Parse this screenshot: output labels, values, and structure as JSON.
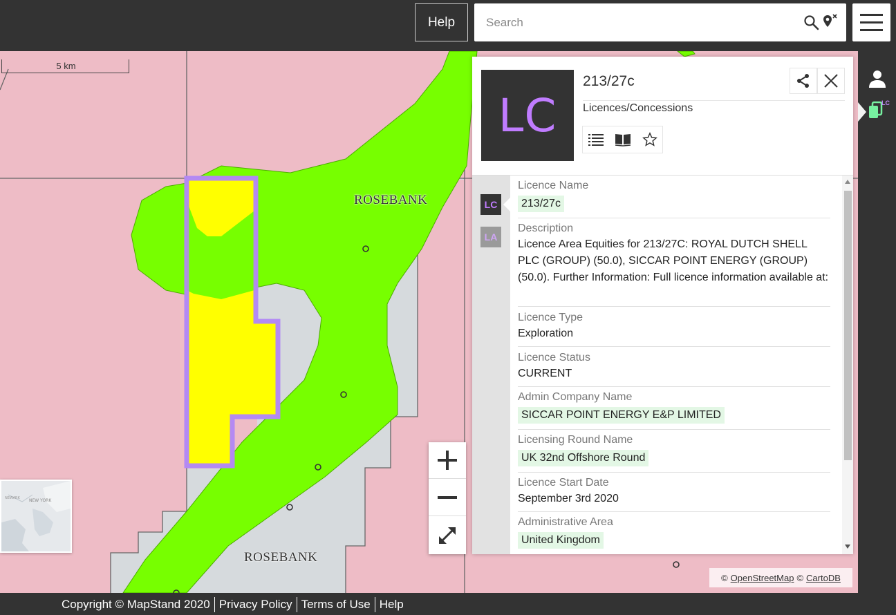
{
  "header": {
    "help_label": "Help",
    "search_placeholder": "Search",
    "search_icon": "search-icon",
    "location_icon": "map-pin-clear-icon",
    "menu_icon": "hamburger-menu-icon"
  },
  "map": {
    "scale_label": "5 km",
    "labels": [
      "ROSEBANK",
      "ROSEBANK"
    ],
    "colors": {
      "background": "#eebcc6",
      "field_green": "#77ff00",
      "block_grey": "#d6dadd",
      "selected_yellow": "#ffff00",
      "selection_outline": "#b388f5"
    },
    "minimap_labels": [
      "NEW YORK",
      "NEWARK"
    ],
    "zoom_in_icon": "plus-icon",
    "zoom_out_icon": "minus-icon",
    "fullscreen_icon": "expand-icon",
    "attribution": {
      "copyright_symbol_1": "©",
      "osm": "OpenStreetMap",
      "copyright_symbol_2": "©",
      "carto": "CartoDB"
    }
  },
  "right_strip": {
    "user_icon": "user-icon",
    "layer_badge": "LC"
  },
  "panel": {
    "logo_text": "LC",
    "title": "213/27c",
    "subtitle": "Licences/Concessions",
    "share_icon": "share-icon",
    "close_icon": "close-icon",
    "tools": [
      "list-icon",
      "book-icon",
      "star-icon"
    ],
    "side_tabs": [
      "LC",
      "LA"
    ],
    "fields": [
      {
        "label": "Licence Name",
        "value": "213/27c",
        "highlight": true
      },
      {
        "label": "Description",
        "value": "Licence Area Equities for 213/27C: ROYAL DUTCH SHELL PLC (GROUP) (50.0), SICCAR POINT ENERGY (GROUP) (50.0). Further Information: Full licence information available at:",
        "highlight": false
      },
      {
        "label": "Licence Type",
        "value": "Exploration",
        "highlight": false
      },
      {
        "label": "Licence Status",
        "value": "CURRENT",
        "highlight": false
      },
      {
        "label": "Admin Company Name",
        "value": "SICCAR POINT ENERGY E&P LIMITED",
        "highlight": true
      },
      {
        "label": "Licensing Round Name",
        "value": "UK 32nd Offshore Round",
        "highlight": true
      },
      {
        "label": "Licence Start Date",
        "value": "September 3rd 2020",
        "highlight": false
      },
      {
        "label": "Administrative Area",
        "value": "United Kingdom",
        "highlight": true
      }
    ]
  },
  "footer": {
    "copyright": "Copyright © MapStand 2020",
    "links": [
      "Privacy Policy",
      "Terms of Use",
      "Help"
    ]
  }
}
